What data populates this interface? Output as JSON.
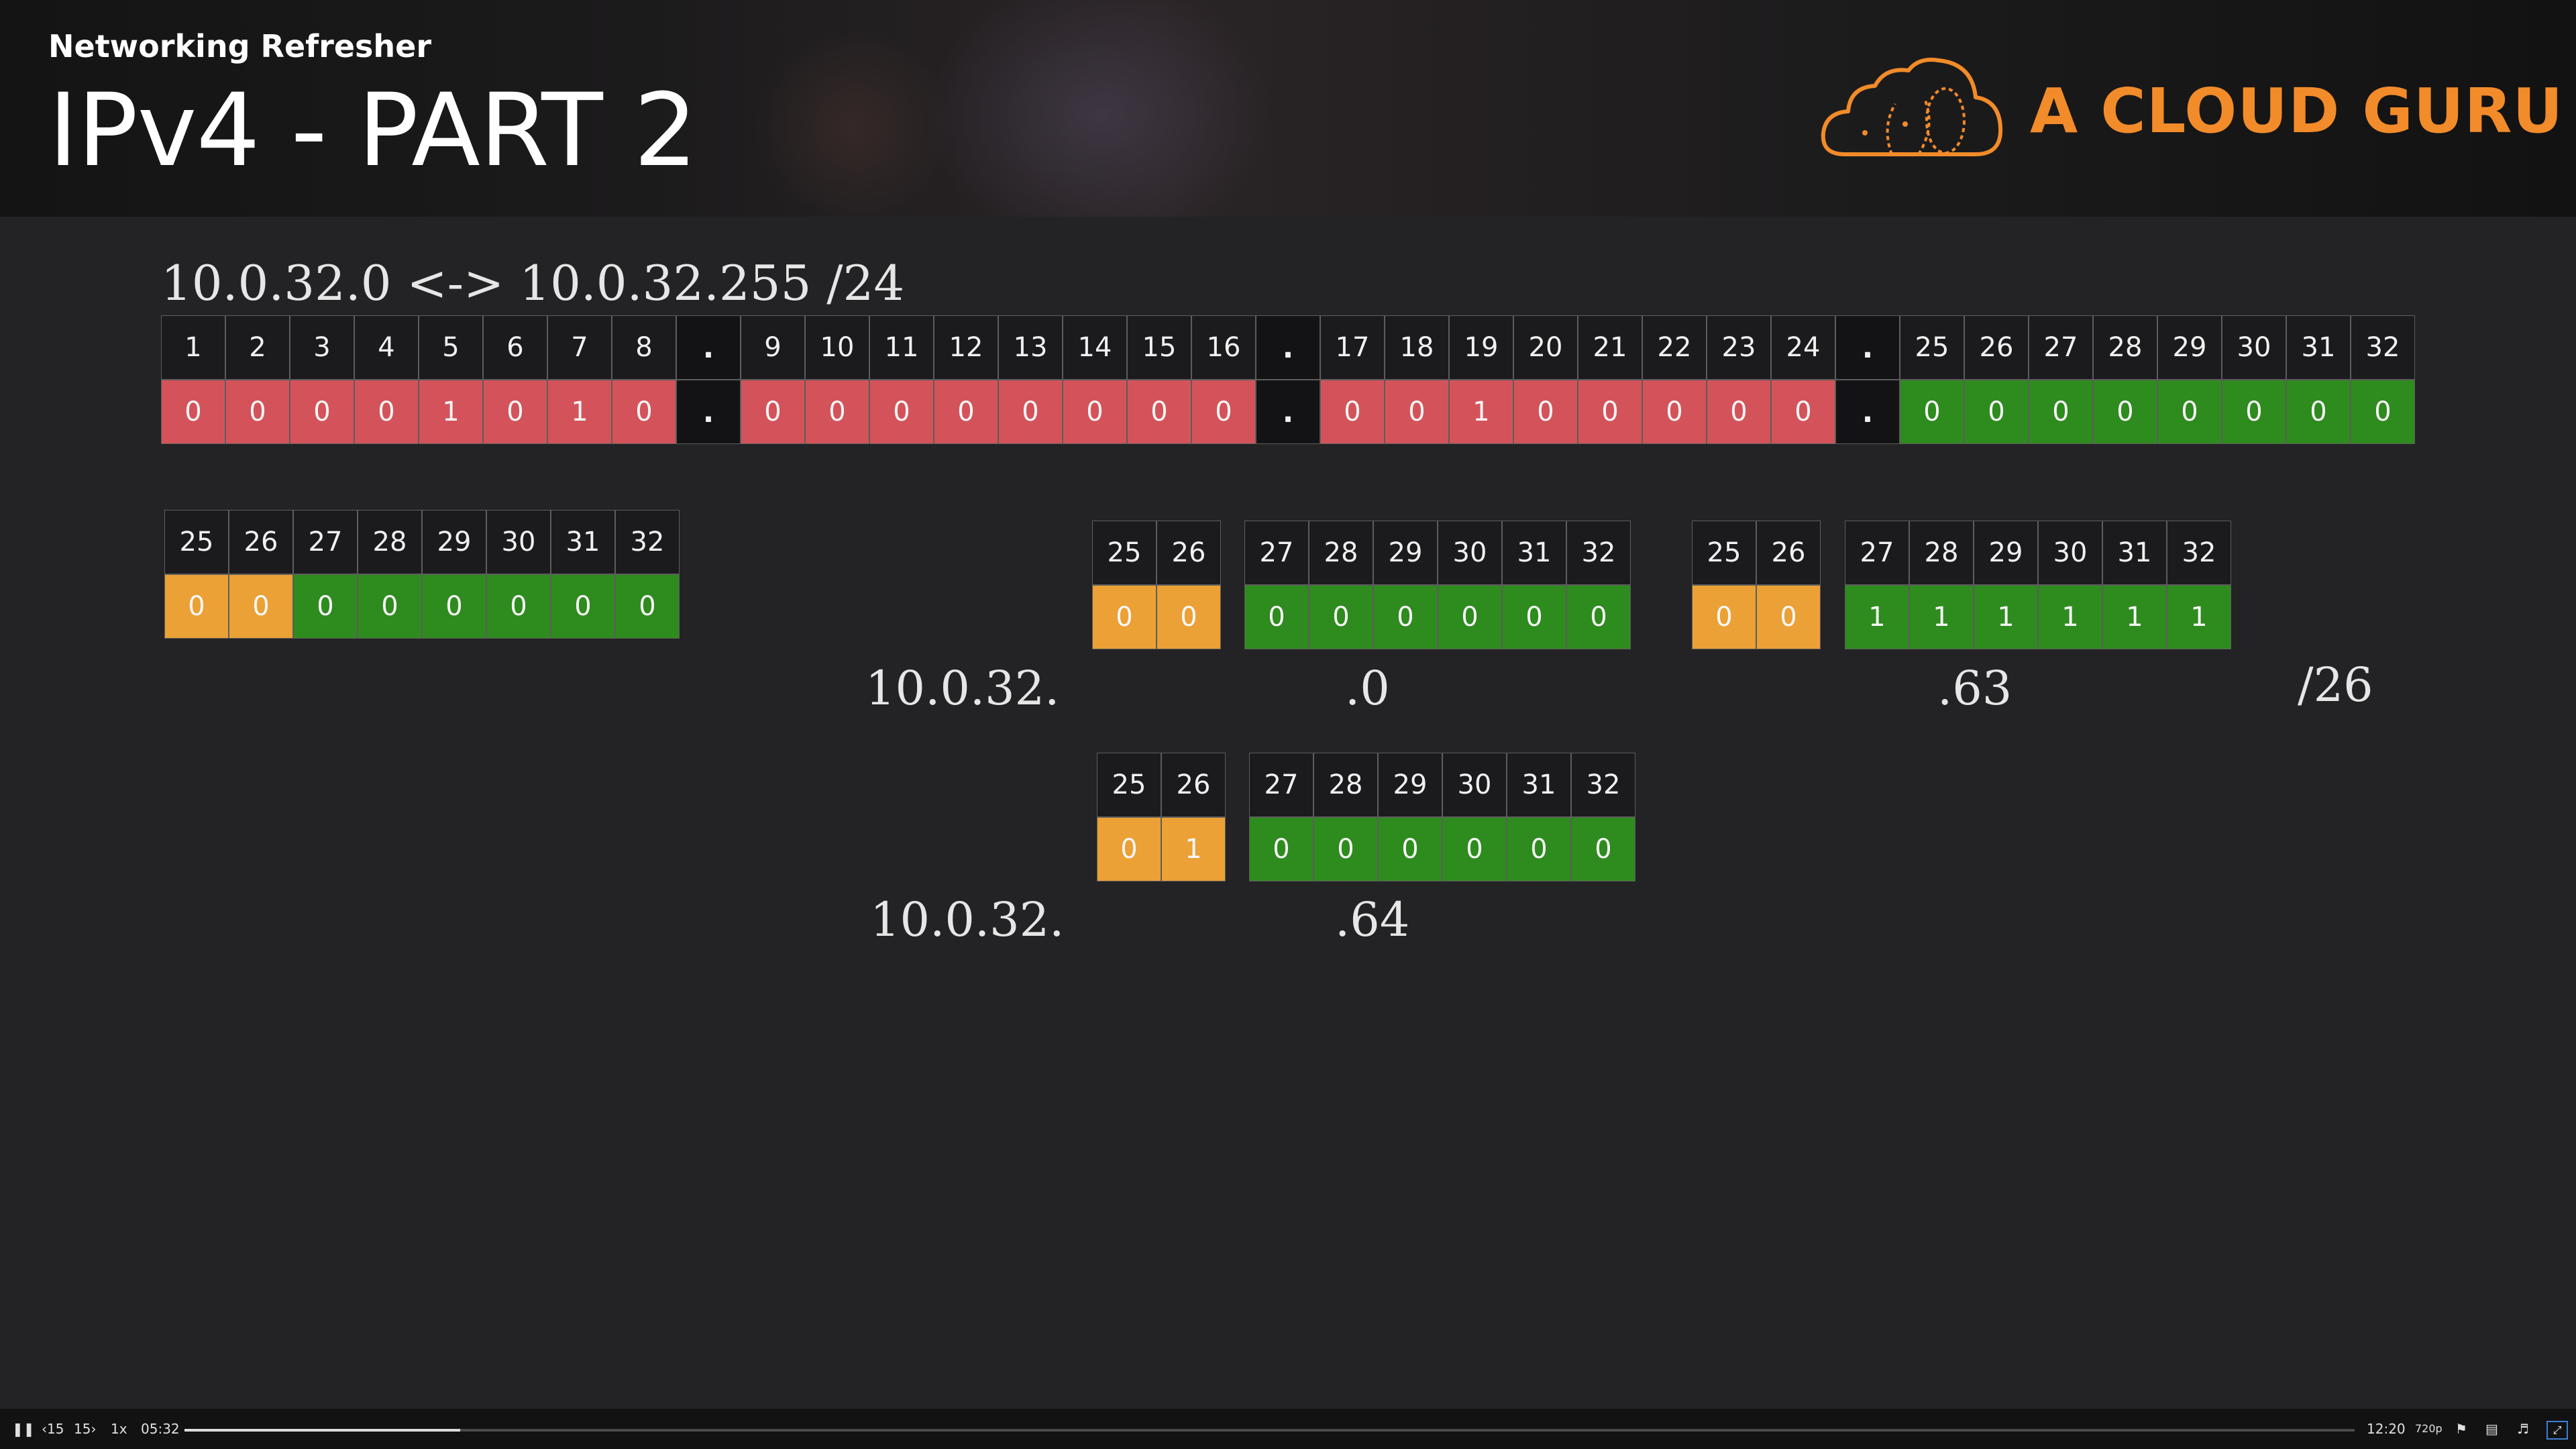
{
  "header": {
    "series": "Networking Refresher",
    "title": "IPv4 - PART 2",
    "brand": {
      "name": "A CLOUD GURU",
      "color": "#f28b2a",
      "icon": "cloud-logo-icon"
    }
  },
  "colors": {
    "network": "#d4535a",
    "host": "#2e8b1e",
    "subnet": "#eba135",
    "background": "#232325"
  },
  "range_heading": "10.0.32.0 <-> 10.0.32.255 /24",
  "address_bits": {
    "headers": [
      "1",
      "2",
      "3",
      "4",
      "5",
      "6",
      "7",
      "8",
      ".",
      "9",
      "10",
      "11",
      "12",
      "13",
      "14",
      "15",
      "16",
      ".",
      "17",
      "18",
      "19",
      "20",
      "21",
      "22",
      "23",
      "24",
      ".",
      "25",
      "26",
      "27",
      "28",
      "29",
      "30",
      "31",
      "32"
    ],
    "values": [
      "0",
      "0",
      "0",
      "0",
      "1",
      "0",
      "1",
      "0",
      ".",
      "0",
      "0",
      "0",
      "0",
      "0",
      "0",
      "0",
      "0",
      ".",
      "0",
      "0",
      "1",
      "0",
      "0",
      "0",
      "0",
      "0",
      ".",
      "0",
      "0",
      "0",
      "0",
      "0",
      "0",
      "0",
      "0"
    ],
    "types": [
      "red",
      "red",
      "red",
      "red",
      "red",
      "red",
      "red",
      "red",
      "dot",
      "red",
      "red",
      "red",
      "red",
      "red",
      "red",
      "red",
      "red",
      "dot",
      "red",
      "red",
      "red",
      "red",
      "red",
      "red",
      "red",
      "red",
      "dot",
      "green",
      "green",
      "green",
      "green",
      "green",
      "green",
      "green",
      "green"
    ]
  },
  "last_octet_bits": {
    "headers": [
      "25",
      "26",
      "27",
      "28",
      "29",
      "30",
      "31",
      "32"
    ],
    "values": [
      "0",
      "0",
      "0",
      "0",
      "0",
      "0",
      "0",
      "0"
    ],
    "types": [
      "orange",
      "orange",
      "green",
      "green",
      "green",
      "green",
      "green",
      "green"
    ]
  },
  "subnet_first": {
    "net_headers": [
      "25",
      "26"
    ],
    "net_values": [
      "0",
      "0"
    ],
    "host_headers": [
      "27",
      "28",
      "29",
      "30",
      "31",
      "32"
    ],
    "host_values": [
      "0",
      "0",
      "0",
      "0",
      "0",
      "0"
    ]
  },
  "subnet_last": {
    "net_headers": [
      "25",
      "26"
    ],
    "net_values": [
      "0",
      "0"
    ],
    "host_headers": [
      "27",
      "28",
      "29",
      "30",
      "31",
      "32"
    ],
    "host_values": [
      "1",
      "1",
      "1",
      "1",
      "1",
      "1"
    ]
  },
  "subnet_next": {
    "net_headers": [
      "25",
      "26"
    ],
    "net_values": [
      "0",
      "1"
    ],
    "host_headers": [
      "27",
      "28",
      "29",
      "30",
      "31",
      "32"
    ],
    "host_values": [
      "0",
      "0",
      "0",
      "0",
      "0",
      "0"
    ]
  },
  "labels": {
    "prefix_1": "10.0.32.",
    "suffix_first": ".0",
    "suffix_last": ".63",
    "cidr": "/26",
    "prefix_2": "10.0.32.",
    "suffix_next": ".64"
  },
  "player": {
    "play_pause_icon": "pause-icon",
    "skip_back": "‹15",
    "skip_forward": "15›",
    "speed": "1x",
    "current_time": "05:32",
    "duration": "12:20",
    "quality": "720p",
    "progress": 0.127,
    "icons": [
      "flag-icon",
      "captions-icon",
      "volume-icon",
      "fullscreen-icon"
    ]
  }
}
